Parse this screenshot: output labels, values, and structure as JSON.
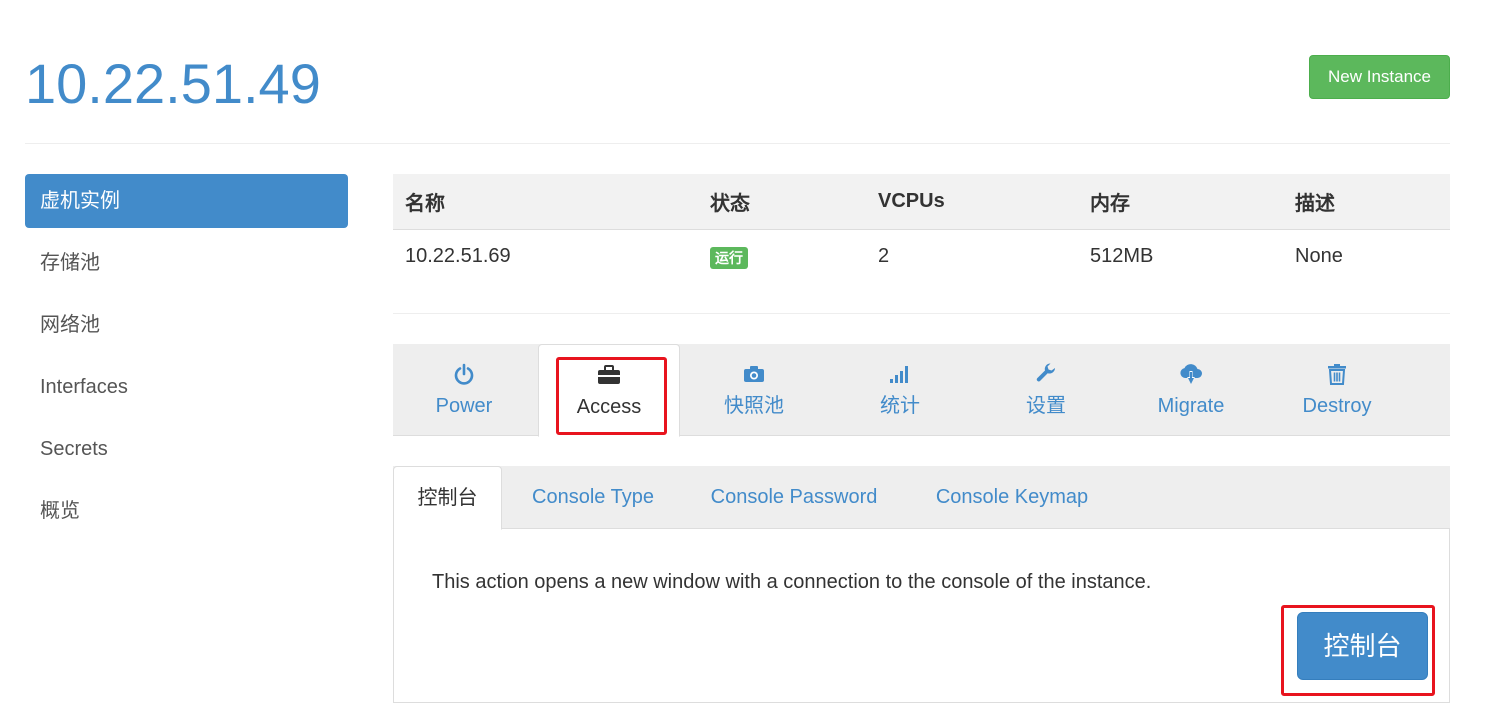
{
  "header": {
    "title": "10.22.51.49",
    "new_instance_label": "New Instance"
  },
  "sidebar": {
    "items": [
      {
        "label": "虚机实例",
        "active": true
      },
      {
        "label": "存储池"
      },
      {
        "label": "网络池"
      },
      {
        "label": "Interfaces"
      },
      {
        "label": "Secrets"
      },
      {
        "label": "概览"
      }
    ]
  },
  "instance_table": {
    "headers": [
      "名称",
      "状态",
      "VCPUs",
      "内存",
      "描述"
    ],
    "row": {
      "name": "10.22.51.69",
      "status": "运行",
      "vcpus": "2",
      "memory": "512MB",
      "description": "None"
    }
  },
  "action_tabs": [
    {
      "label": "Power",
      "icon": "power-icon"
    },
    {
      "label": "Access",
      "icon": "briefcase-icon",
      "active": true
    },
    {
      "label": "快照池",
      "icon": "camera-icon"
    },
    {
      "label": "统计",
      "icon": "signal-bars-icon"
    },
    {
      "label": "设置",
      "icon": "wrench-icon"
    },
    {
      "label": "Migrate",
      "icon": "cloud-download-icon"
    },
    {
      "label": "Destroy",
      "icon": "trash-icon"
    }
  ],
  "sub_tabs": [
    {
      "label": "控制台",
      "active": true
    },
    {
      "label": "Console Type"
    },
    {
      "label": "Console Password"
    },
    {
      "label": "Console Keymap"
    }
  ],
  "console_panel": {
    "description": "This action opens a new window with a connection to the console of the instance.",
    "button_label": "控制台"
  },
  "colors": {
    "primary": "#428bca",
    "success": "#5cb85c",
    "highlight": "#e8141e"
  }
}
